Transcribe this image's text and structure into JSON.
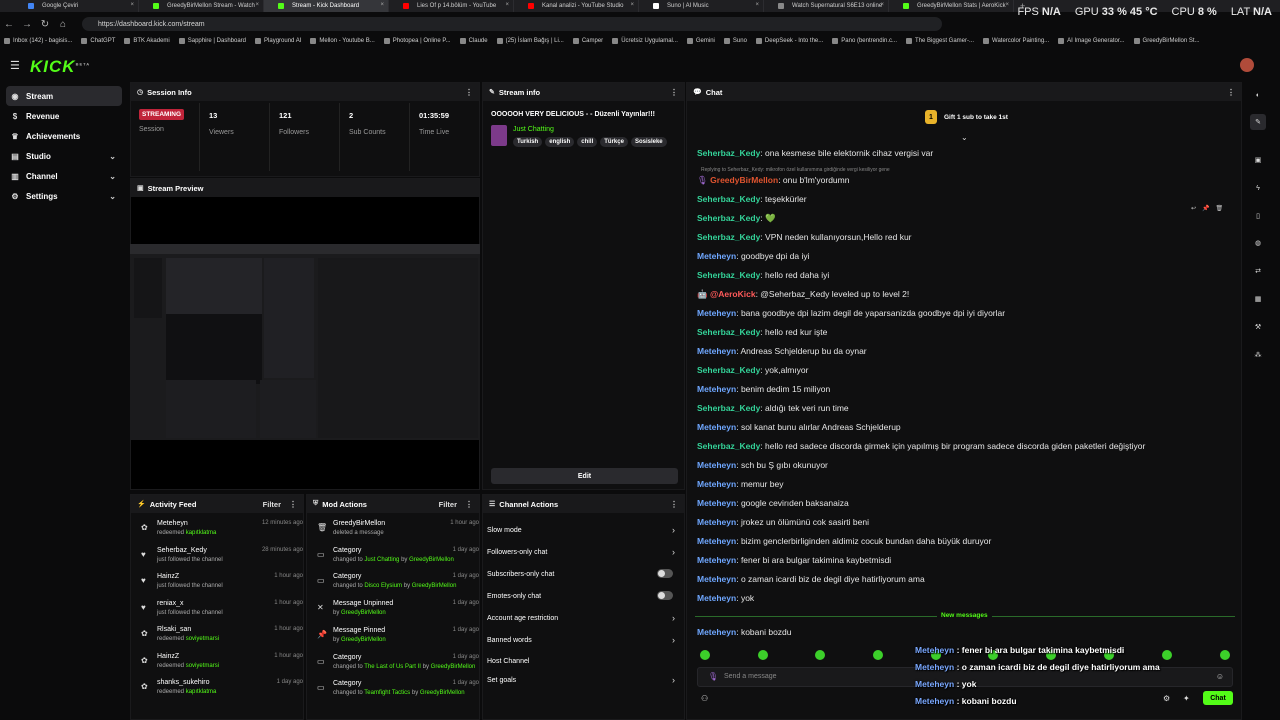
{
  "browser": {
    "tabs": [
      {
        "title": "Google Çeviri",
        "color": "#4285f4",
        "active": false
      },
      {
        "title": "GreedyBirMellon Stream - Watch",
        "color": "#53fc18",
        "active": false
      },
      {
        "title": "Stream - Kick Dashboard",
        "color": "#53fc18",
        "active": true
      },
      {
        "title": "Lies Of p 14.bölüm - YouTube",
        "color": "#ff0000",
        "active": false
      },
      {
        "title": "Kanal analizi - YouTube Studio",
        "color": "#ff0000",
        "active": false
      },
      {
        "title": "Suno | AI Music",
        "color": "#ffffff",
        "active": false
      },
      {
        "title": "Watch Supernatural S6E13 online",
        "color": "#888888",
        "active": false
      },
      {
        "title": "GreedyBirMellon Stats | AeroKick",
        "color": "#53fc18",
        "active": false
      }
    ],
    "url": "https://dashboard.kick.com/stream",
    "bookmarks": [
      "Inbox (142) - bagisis...",
      "ChatGPT",
      "BTK Akademi",
      "Sapphire | Dashboard",
      "Playground AI",
      "Mellon - Youtube B...",
      "Photopea | Online P...",
      "Claude",
      "(25) İslam Bağış | Li...",
      "Camper",
      "Ücretsiz Uygulamal...",
      "Gemini",
      "Suno",
      "DeepSeek - Into the...",
      "Pano (bentrendin.c...",
      "The Biggest Gamer-...",
      "Watercolor Painting...",
      "AI Image Generator...",
      "GreedyBirMellon St..."
    ],
    "perf": {
      "fps_label": "FPS",
      "fps": "N/A",
      "gpu_label": "GPU",
      "gpu": "33 % 45 °C",
      "cpu_label": "CPU",
      "cpu": "8 %",
      "lat_label": "LAT",
      "lat": "N/A"
    }
  },
  "app": {
    "logo": "KICK",
    "logo_badge": "BETA",
    "nav": [
      {
        "label": "Stream",
        "icon": "broadcast-icon",
        "active": true,
        "chevron": false
      },
      {
        "label": "Revenue",
        "icon": "dollar-icon",
        "active": false,
        "chevron": false
      },
      {
        "label": "Achievements",
        "icon": "trophy-icon",
        "active": false,
        "chevron": false
      },
      {
        "label": "Studio",
        "icon": "studio-icon",
        "active": false,
        "chevron": true
      },
      {
        "label": "Channel",
        "icon": "channel-icon",
        "active": false,
        "chevron": true
      },
      {
        "label": "Settings",
        "icon": "gear-icon",
        "active": false,
        "chevron": true
      }
    ]
  },
  "session": {
    "title": "Session Info",
    "status": "STREAMING",
    "status_label": "Session",
    "stats": [
      {
        "value": "13",
        "label": "Viewers"
      },
      {
        "value": "121",
        "label": "Followers"
      },
      {
        "value": "2",
        "label": "Sub Counts"
      },
      {
        "value": "01:35:59",
        "label": "Time Live"
      }
    ]
  },
  "preview": {
    "title": "Stream Preview"
  },
  "stream_info": {
    "title": "Stream info",
    "stream_title": "OOOOOH VERY DELICIOUS - - Düzenli Yayınlar!!!",
    "category": "Just Chatting",
    "tags": [
      "Turkish",
      "english",
      "chill",
      "Türkçe",
      "Sosisleke"
    ],
    "edit_label": "Edit"
  },
  "activity": {
    "title": "Activity Feed",
    "filter": "Filter",
    "items": [
      {
        "name": "Meteheyn",
        "desc": "redeemed",
        "target": "kapıtklatma",
        "time": "12 minutes ago",
        "icon": "gift-icon"
      },
      {
        "name": "Seherbaz_Kedy",
        "desc": "just followed the channel",
        "target": "",
        "time": "28 minutes ago",
        "icon": "heart-icon"
      },
      {
        "name": "HainzZ",
        "desc": "just followed the channel",
        "target": "",
        "time": "1 hour ago",
        "icon": "heart-icon"
      },
      {
        "name": "reniax_x",
        "desc": "just followed the channel",
        "target": "",
        "time": "1 hour ago",
        "icon": "heart-icon"
      },
      {
        "name": "Rlsaki_san",
        "desc": "redeemed",
        "target": "soviyetmarsi",
        "time": "1 hour ago",
        "icon": "gift-icon"
      },
      {
        "name": "HainzZ",
        "desc": "redeemed",
        "target": "soviyetmarsi",
        "time": "1 hour ago",
        "icon": "gift-icon"
      },
      {
        "name": "shanks_sukehiro",
        "desc": "redeemed",
        "target": "kapıtklatma",
        "time": "1 day ago",
        "icon": "gift-icon"
      }
    ]
  },
  "mod": {
    "title": "Mod Actions",
    "filter": "Filter",
    "items": [
      {
        "name": "GreedyBirMellon",
        "pre": "deleted a message",
        "target": "",
        "mid": "",
        "target2": "",
        "time": "1 hour ago",
        "icon": "trash-icon"
      },
      {
        "name": "Category",
        "pre": "changed to",
        "target": "Just Chatting",
        "mid": "by",
        "target2": "GreedyBirMellon",
        "time": "1 day ago",
        "icon": "category-icon"
      },
      {
        "name": "Category",
        "pre": "changed to",
        "target": "Disco Elysium",
        "mid": "by",
        "target2": "GreedyBirMellon",
        "time": "1 day ago",
        "icon": "category-icon"
      },
      {
        "name": "Message Unpinned",
        "pre": "by",
        "target": "GreedyBirMellon",
        "mid": "",
        "target2": "",
        "time": "1 day ago",
        "icon": "unpin-icon"
      },
      {
        "name": "Message Pinned",
        "pre": "by",
        "target": "GreedyBirMellon",
        "mid": "",
        "target2": "",
        "time": "1 day ago",
        "icon": "pin-icon"
      },
      {
        "name": "Category",
        "pre": "changed to",
        "target": "The Last of Us Part II",
        "mid": "by",
        "target2": "GreedyBirMellon",
        "time": "1 day ago",
        "icon": "category-icon"
      },
      {
        "name": "Category",
        "pre": "changed to",
        "target": "Teamfight Tactics",
        "mid": "by",
        "target2": "GreedyBirMellon",
        "time": "1 day ago",
        "icon": "category-icon"
      }
    ]
  },
  "channel_actions": {
    "title": "Channel Actions",
    "items": [
      {
        "label": "Slow mode",
        "control": "chevron"
      },
      {
        "label": "Followers-only chat",
        "control": "chevron"
      },
      {
        "label": "Subscribers-only chat",
        "control": "toggle"
      },
      {
        "label": "Emotes-only chat",
        "control": "toggle"
      },
      {
        "label": "Account age restriction",
        "control": "chevron"
      },
      {
        "label": "Banned words",
        "control": "chevron"
      },
      {
        "label": "Host Channel",
        "control": "none"
      },
      {
        "label": "Set goals",
        "control": "chevron"
      }
    ]
  },
  "chat": {
    "title": "Chat",
    "gift_rank": "1",
    "gift_text": "Gift 1 sub to take 1st",
    "reply_note": "Replying to Seherbaz_Kedy: mikrofon özel kullanımına girdiğinde vergi kesiliyor gene",
    "messages": [
      {
        "user": "Seherbaz_Kedy",
        "text": ": ona kesmese bile elektornik cihaz vergisi var",
        "c": "ug"
      },
      {
        "user": "GreedyBirMellon",
        "text": ": onu b'lm'yordumn",
        "c": "uo"
      },
      {
        "user": "Seherbaz_Kedy",
        "text": ": teşekkürler",
        "c": "ug"
      },
      {
        "user": "Seherbaz_Kedy",
        "text": ": 💚",
        "c": "ug"
      },
      {
        "user": "Seherbaz_Kedy",
        "text": ": VPN neden kullanıyorsun,Hello red kur",
        "c": "ug"
      },
      {
        "user": "Meteheyn",
        "text": ": goodbye dpi da iyi",
        "c": "ub"
      },
      {
        "user": "Seherbaz_Kedy",
        "text": ": hello red daha iyi",
        "c": "ug"
      },
      {
        "user": "@AeroKick",
        "text": ": @Seherbaz_Kedy leveled up to level 2!",
        "c": "ur"
      },
      {
        "user": "Meteheyn",
        "text": ": bana goodbye dpi lazim degil de yaparsanizda goodbye dpi iyi diyorlar",
        "c": "ub"
      },
      {
        "user": "Seherbaz_Kedy",
        "text": ": hello red kur işte",
        "c": "ug"
      },
      {
        "user": "Meteheyn",
        "text": ": Andreas Schjelderup bu da oynar",
        "c": "ub"
      },
      {
        "user": "Seherbaz_Kedy",
        "text": ": yok,almıyor",
        "c": "ug"
      },
      {
        "user": "Meteheyn",
        "text": ": benim dedim 15 miliyon",
        "c": "ub"
      },
      {
        "user": "Seherbaz_Kedy",
        "text": ": aldığı tek veri run time",
        "c": "ug"
      },
      {
        "user": "Meteheyn",
        "text": ": sol kanat bunu alırlar Andreas Schjelderup",
        "c": "ub"
      },
      {
        "user": "Seherbaz_Kedy",
        "text": ": hello red sadece discorda girmek için yapılmış bir program sadece discorda giden paketleri değiştiyor",
        "c": "ug"
      },
      {
        "user": "Meteheyn",
        "text": ": sch bu Ş gıbı okunuyor",
        "c": "ub"
      },
      {
        "user": "Meteheyn",
        "text": ": memur bey",
        "c": "ub"
      },
      {
        "user": "Meteheyn",
        "text": ": google cevirıden baksanaiza",
        "c": "ub"
      },
      {
        "user": "Meteheyn",
        "text": ": jrokez un ölümünü cok sasirti beni",
        "c": "ub"
      },
      {
        "user": "Meteheyn",
        "text": ": bizim genclerbirliginden aldimiz cocuk bundan daha büyük duruyor",
        "c": "ub"
      },
      {
        "user": "Meteheyn",
        "text": ": fener bi ara bulgar takimina kaybetmisdi",
        "c": "ub"
      },
      {
        "user": "Meteheyn",
        "text": ": o zaman icardi biz de degil diye hatirliyorum ama",
        "c": "ub"
      },
      {
        "user": "Meteheyn",
        "text": ": yok",
        "c": "ub"
      }
    ],
    "new_messages": "New messages",
    "last": {
      "user": "Meteheyn",
      "text": ": kobani bozdu",
      "c": "ub"
    },
    "placeholder": "Send a message",
    "send": "Chat",
    "overlay": [
      {
        "user": "Meteheyn",
        "text": " : fener bi ara bulgar takimina kaybetmisdi"
      },
      {
        "user": "Meteheyn",
        "text": " : o zaman icardi biz de degil diye hatirliyorum ama"
      },
      {
        "user": "Meteheyn",
        "text": " : yok"
      },
      {
        "user": "Meteheyn",
        "text": " : kobani bozdu"
      }
    ]
  },
  "colors": {
    "accent": "#53fc18",
    "panel": "#0f0f10",
    "header": "#19191b"
  }
}
